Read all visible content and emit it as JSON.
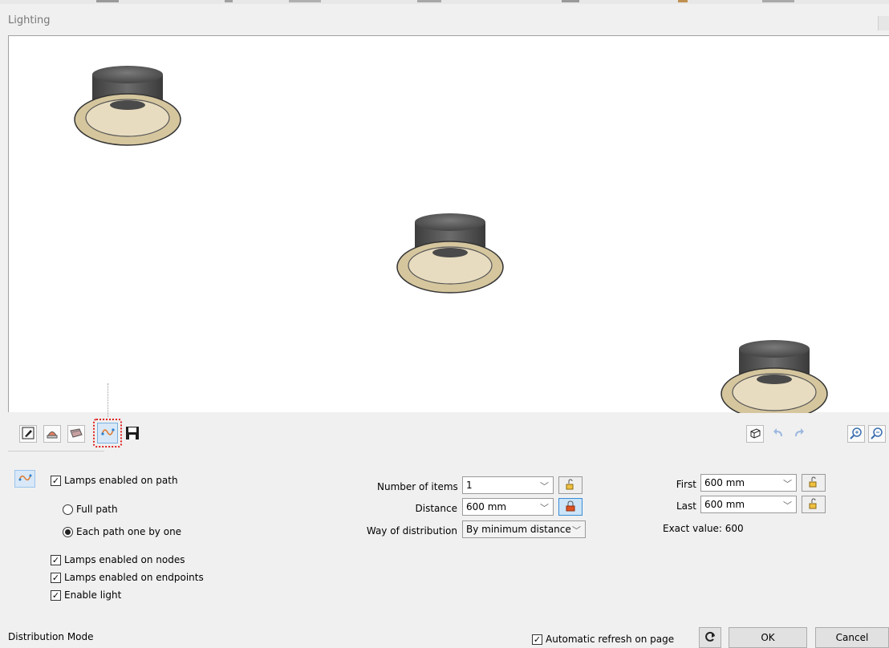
{
  "window": {
    "title": "Lighting"
  },
  "toolbar": {
    "left_icons": [
      "edit-icon",
      "lamp-icon",
      "material-icon",
      "path-distribution-icon",
      "save-icon"
    ],
    "right_icons": [
      "3d-box-icon",
      "undo-icon",
      "redo-icon",
      "zoom-in-icon",
      "zoom-out-icon"
    ]
  },
  "options": {
    "lamps_on_path": {
      "label": "Lamps enabled on path",
      "checked": true
    },
    "full_path": {
      "label": "Full path",
      "selected": false
    },
    "each_path": {
      "label": "Each path one by one",
      "selected": true
    },
    "lamps_on_nodes": {
      "label": "Lamps enabled on nodes",
      "checked": true
    },
    "lamps_on_endpoints": {
      "label": "Lamps enabled on endpoints",
      "checked": true
    },
    "enable_light": {
      "label": "Enable light",
      "checked": true
    }
  },
  "params": {
    "number_of_items": {
      "label": "Number of items",
      "value": "1"
    },
    "distance": {
      "label": "Distance",
      "value": "600 mm"
    },
    "way_of_distribution": {
      "label": "Way of distribution",
      "value": "By minimum distance"
    }
  },
  "offsets": {
    "first": {
      "label": "First",
      "value": "600 mm"
    },
    "last": {
      "label": "Last",
      "value": "600 mm"
    },
    "exact_value": "Exact value: 600"
  },
  "footer": {
    "mode_label": "Distribution Mode",
    "auto_refresh": {
      "label": "Automatic refresh on page",
      "checked": true
    },
    "ok": "OK",
    "cancel": "Cancel"
  },
  "colors": {
    "highlight": "#e02020",
    "lamp_trim": "#d9caa3",
    "lamp_body": "#555555"
  }
}
